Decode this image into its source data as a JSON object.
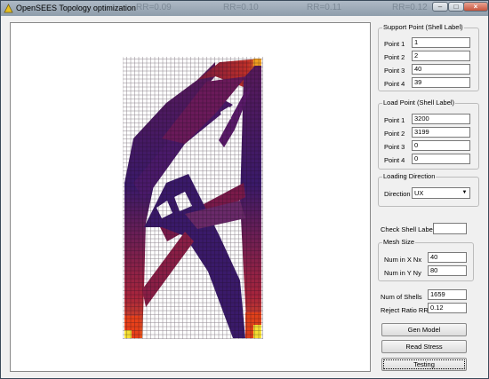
{
  "window": {
    "title": "OpenSEES Topology optimization",
    "background_titles": [
      "RR=0.09",
      "RR=0.10",
      "RR=0.11",
      "RR=0.12"
    ]
  },
  "support_point": {
    "legend": "Support Point (Shell Label)",
    "rows": [
      {
        "label": "Point 1",
        "value": "1"
      },
      {
        "label": "Point 2",
        "value": "2"
      },
      {
        "label": "Point 3",
        "value": "40"
      },
      {
        "label": "Point 4",
        "value": "39"
      }
    ]
  },
  "load_point": {
    "legend": "Load Point (Shell Label)",
    "rows": [
      {
        "label": "Point 1",
        "value": "3200"
      },
      {
        "label": "Point 2",
        "value": "3199"
      },
      {
        "label": "Point 3",
        "value": "0"
      },
      {
        "label": "Point 4",
        "value": "0"
      }
    ]
  },
  "loading_direction": {
    "legend": "Loading Direction",
    "label": "Direction",
    "value": "UX"
  },
  "check_shell": {
    "label": "Check Shell Label",
    "value": ""
  },
  "mesh_size": {
    "legend": "Mesh Size",
    "nx_label": "Num in X Nx",
    "nx_value": "40",
    "ny_label": "Num in Y Ny",
    "ny_value": "80"
  },
  "results": {
    "shells_label": "Num of Shells",
    "shells_value": "1659",
    "rr_label": "Reject Ratio RR",
    "rr_value": "0.12"
  },
  "buttons": {
    "gen_model": "Gen Model",
    "read_stress": "Read Stress",
    "testing": "Testing"
  },
  "colors": {
    "low": "#2a1460",
    "mid": "#8b1e4a",
    "high": "#e04a18",
    "peak": "#f6e033"
  }
}
